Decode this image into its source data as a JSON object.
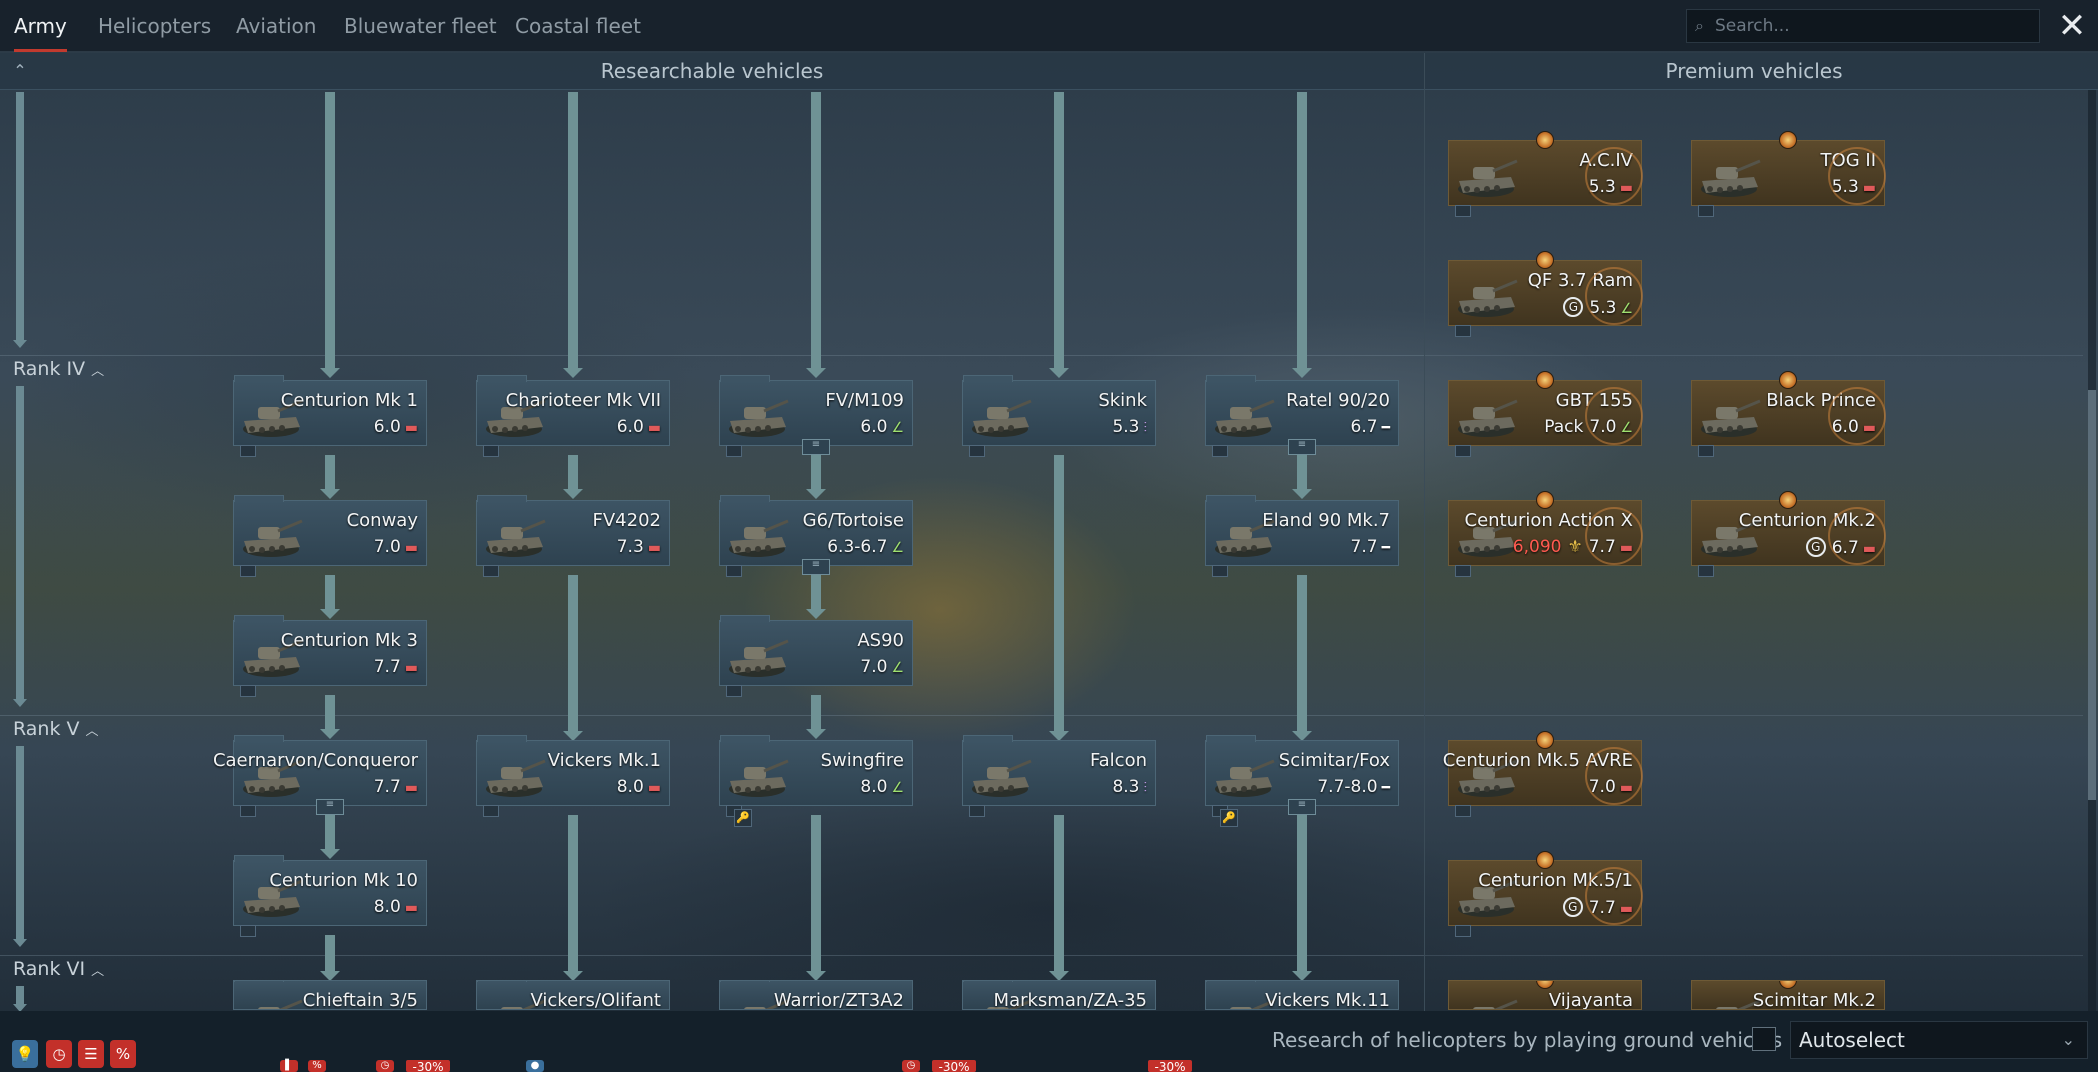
{
  "tabs": [
    {
      "label": "Army",
      "active": true
    },
    {
      "label": "Helicopters"
    },
    {
      "label": "Aviation"
    },
    {
      "label": "Bluewater fleet"
    },
    {
      "label": "Coastal fleet"
    }
  ],
  "search": {
    "placeholder": "Search..."
  },
  "close_icon": "close-icon",
  "sections": {
    "researchable": "Researchable vehicles",
    "premium": "Premium vehicles"
  },
  "ranks": [
    {
      "label": "Rank IV"
    },
    {
      "label": "Rank V"
    },
    {
      "label": "Rank VI"
    }
  ],
  "vehicles": [
    {
      "name": "Centurion Mk 1",
      "br": "6.0",
      "cls": "heavy",
      "icon": "heavy-tank-icon"
    },
    {
      "name": "Charioteer Mk VII",
      "br": "6.0",
      "cls": "heavy",
      "icon": "heavy-tank-icon"
    },
    {
      "name": "FV/M109",
      "br": "6.0",
      "cls": "spg",
      "icon": "spg-icon",
      "group": true
    },
    {
      "name": "Skink",
      "br": "5.3",
      "cls": "spaa",
      "icon": "spaa-icon"
    },
    {
      "name": "Ratel 90/20",
      "br": "6.7",
      "cls": "light",
      "icon": "light-tank-icon",
      "group": true
    },
    {
      "name": "Conway",
      "br": "7.0",
      "cls": "heavy",
      "icon": "heavy-tank-icon"
    },
    {
      "name": "FV4202",
      "br": "7.3",
      "cls": "heavy",
      "icon": "heavy-tank-icon"
    },
    {
      "name": "G6/Tortoise",
      "br": "6.3-6.7",
      "cls": "spg",
      "icon": "spg-icon",
      "group": true
    },
    {
      "name": "Eland 90 Mk.7",
      "br": "7.7",
      "cls": "light",
      "icon": "light-tank-icon"
    },
    {
      "name": "Centurion Mk 3",
      "br": "7.7",
      "cls": "heavy",
      "icon": "heavy-tank-icon"
    },
    {
      "name": "AS90",
      "br": "7.0",
      "cls": "spg",
      "icon": "spg-icon"
    },
    {
      "name": "Caernarvon/Conqueror",
      "br": "7.7",
      "cls": "heavy",
      "icon": "heavy-tank-icon",
      "group": true
    },
    {
      "name": "Vickers Mk.1",
      "br": "8.0",
      "cls": "heavy",
      "icon": "heavy-tank-icon"
    },
    {
      "name": "Swingfire",
      "br": "8.0",
      "cls": "spg",
      "icon": "spg-icon"
    },
    {
      "name": "Falcon",
      "br": "8.3",
      "cls": "spaa",
      "icon": "spaa-icon"
    },
    {
      "name": "Scimitar/Fox",
      "br": "7.7-8.0",
      "cls": "light",
      "icon": "light-tank-icon",
      "group": true
    },
    {
      "name": "Centurion Mk 10",
      "br": "8.0",
      "cls": "heavy",
      "icon": "heavy-tank-icon"
    },
    {
      "name": "Chieftain 3/5",
      "br": "",
      "cls": "heavy"
    },
    {
      "name": "Vickers/Olifant",
      "br": "",
      "cls": "heavy"
    },
    {
      "name": "Warrior/ZT3A2",
      "br": "",
      "cls": "spg"
    },
    {
      "name": "Marksman/ZA-35",
      "br": "",
      "cls": "spaa"
    },
    {
      "name": "Vickers Mk.11",
      "br": "",
      "cls": "light"
    }
  ],
  "premium": [
    {
      "name": "A.C.IV",
      "br": "5.3",
      "cls": "heavy",
      "icon": "medium-tank-icon"
    },
    {
      "name": "TOG II",
      "br": "5.3",
      "cls": "heavy",
      "icon": "heavy-tank-icon"
    },
    {
      "name": "QF 3.7 Ram",
      "br": "5.3",
      "cls": "spg",
      "icon": "spg-icon",
      "ge": true
    },
    {
      "name": "GBT 155",
      "sub": "Pack",
      "br": "7.0",
      "cls": "spg",
      "icon": "spg-icon"
    },
    {
      "name": "Black Prince",
      "br": "6.0",
      "cls": "heavy",
      "icon": "heavy-tank-icon"
    },
    {
      "name": "Centurion Action X",
      "cost": "6,090",
      "br": "7.7",
      "cls": "heavy",
      "icon": "medium-tank-icon"
    },
    {
      "name": "Centurion Mk.2",
      "br": "6.7",
      "cls": "heavy",
      "icon": "medium-tank-icon",
      "ge": true
    },
    {
      "name": "Centurion Mk.5 AVRE",
      "br": "7.0",
      "cls": "heavy",
      "icon": "medium-tank-icon"
    },
    {
      "name": "Centurion Mk.5/1",
      "br": "7.7",
      "cls": "heavy",
      "icon": "medium-tank-icon",
      "ge": true
    },
    {
      "name": "Vijayanta",
      "br": "",
      "cls": "heavy"
    },
    {
      "name": "Scimitar Mk.2",
      "br": "",
      "cls": "light"
    }
  ],
  "footer": {
    "helicopters_label": "Research of helicopters by playing ground vehicles",
    "autoselect": "Autoselect",
    "discounts": [
      "-30%",
      "-30%",
      "-30%"
    ]
  },
  "icons": {
    "ge": "G",
    "cost_currency": "silver-lions-icon",
    "ge_icon": "golden-eagles-icon"
  }
}
